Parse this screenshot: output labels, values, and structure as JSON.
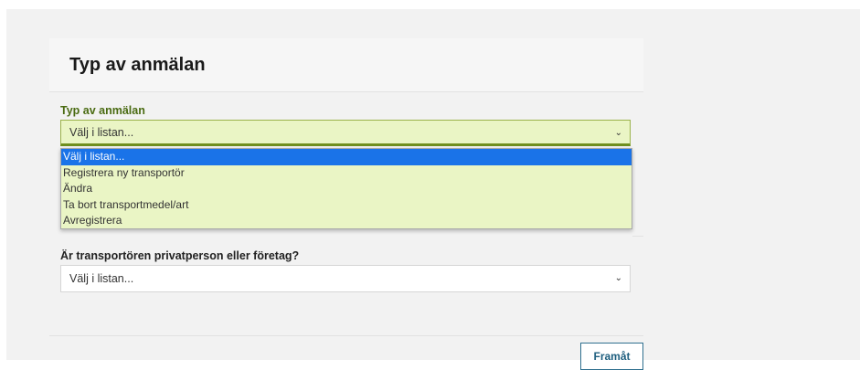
{
  "card": {
    "title": "Typ av anmälan"
  },
  "fields": {
    "notification_type": {
      "label": "Typ av anmälan",
      "value": "Välj i listan...",
      "options": [
        "Välj i listan...",
        "Registrera ny transportör",
        "Ändra",
        "Ta bort transportmedel/art",
        "Avregistrera"
      ],
      "selected_index": 0
    },
    "private_or_company": {
      "label": "Är transportören privatperson eller företag?",
      "value": "Välj i listan..."
    }
  },
  "actions": {
    "next_label": "Framåt"
  },
  "icons": {
    "select_caret": "chevron-down-icon"
  },
  "colors": {
    "highlight_bg": "#eaf5c5",
    "label_green": "#4a6b12",
    "selected_option": "#1a73e8",
    "button_border": "#2f6f8f"
  }
}
